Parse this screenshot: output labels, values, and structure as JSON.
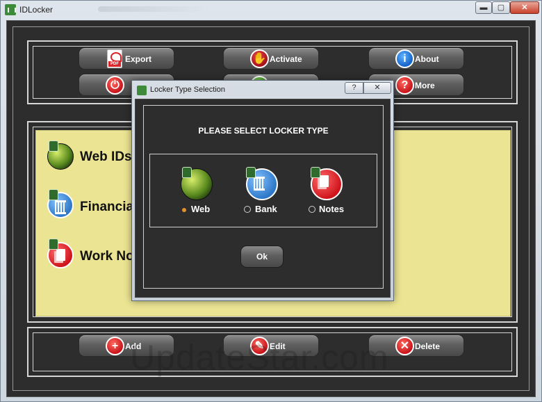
{
  "window": {
    "title": "IDLocker",
    "min": "▬",
    "max": "▢",
    "close": "✕"
  },
  "toolbar_top": {
    "export_label": "Export",
    "activate_label": "Activate",
    "about_label": "About",
    "more_label": "More"
  },
  "locker_list": [
    {
      "label": "Web IDs"
    },
    {
      "label": "Financial"
    },
    {
      "label": "Work No"
    }
  ],
  "toolbar_bottom": {
    "add_label": "Add",
    "edit_label": "Edit",
    "delete_label": "Delete"
  },
  "dialog": {
    "title": "Locker Type Selection",
    "help": "?",
    "close": "✕",
    "heading": "PLEASE SELECT LOCKER TYPE",
    "options": [
      {
        "label": "Web",
        "selected": true
      },
      {
        "label": "Bank",
        "selected": false
      },
      {
        "label": "Notes",
        "selected": false
      }
    ],
    "ok_label": "Ok"
  },
  "watermark": "UpdateStar.com",
  "colors": {
    "panel_background": "#2d2d2d",
    "list_background": "#ebe493",
    "radio_selected": "#e3932b"
  },
  "icons": {
    "export": "pdf-icon",
    "activate": "hand-icon",
    "about": "info-icon",
    "more": "question-icon",
    "add": "plus-icon",
    "edit": "pencil-icon",
    "delete": "x-icon"
  }
}
